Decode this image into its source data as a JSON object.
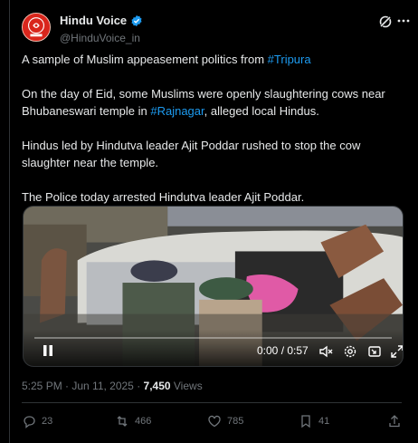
{
  "author": {
    "display_name": "Hindu Voice",
    "handle": "@HinduVoice_in",
    "verified": true,
    "verified_color": "#1d9bf0"
  },
  "body": {
    "p1_text": "A sample of Muslim appeasement politics from ",
    "p1_hashtag": "#Tripura",
    "p2_text_a": "On the day of Eid, some Muslims were openly slaughtering cows near Bhubaneswari temple in ",
    "p2_hashtag": "#Rajnagar",
    "p2_text_b": ", alleged local Hindus.",
    "p3": "Hindus led by Hindutva leader Ajit Poddar rushed to stop the cow slaughter near the temple.",
    "p4": "The Police today arrested Hindutva leader Ajit Poddar."
  },
  "video": {
    "time": "0:00 / 0:57",
    "progress": 0.0,
    "controls": [
      "pause-icon",
      "mute-icon",
      "settings-icon",
      "picture-in-picture-icon",
      "fullscreen-icon"
    ]
  },
  "meta": {
    "timestamp": "5:25 PM · Jun 11, 2025 · ",
    "views_count": "7,450",
    "views_label": " Views"
  },
  "actions": {
    "replies": "23",
    "reposts": "466",
    "likes": "785",
    "bookmarks": "41"
  },
  "colors": {
    "background": "#000000",
    "text": "#e7e9ea",
    "muted": "#71767b",
    "link": "#1d9bf0",
    "border": "#2f3336"
  }
}
